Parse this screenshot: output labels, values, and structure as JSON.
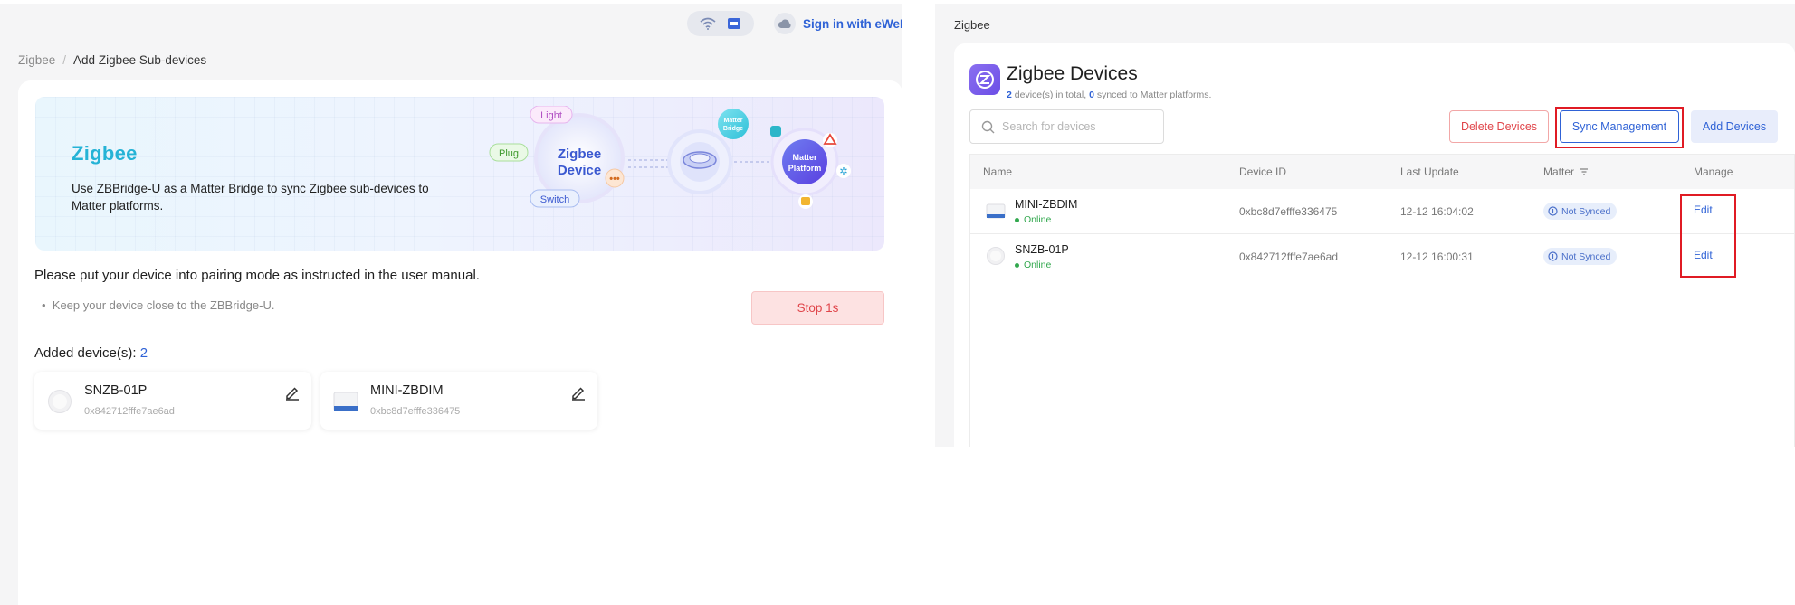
{
  "left": {
    "topbar": {
      "wifi_icon": "wifi-icon",
      "device_icon": "bridge-icon",
      "cloud_icon": "cloud-icon",
      "signin_label": "Sign in with eWeLi"
    },
    "breadcrumb": {
      "root": "Zigbee",
      "separator": "/",
      "current": "Add Zigbee Sub-devices"
    },
    "banner": {
      "brand": "Zigbee",
      "description": "Use ZBBridge-U as a Matter Bridge to sync Zigbee sub-devices to Matter platforms.",
      "illustration": {
        "center_line1": "Zigbee",
        "center_line2": "Device",
        "tag_light": "Light",
        "tag_plug": "Plug",
        "tag_switch": "Switch",
        "matter_bridge_line1": "Matter",
        "matter_bridge_line2": "Bridge",
        "matter_platform_line1": "Matter",
        "matter_platform_line2": "Platform"
      }
    },
    "instruction": "Please put your device into pairing mode as instructed in the user manual.",
    "tip": "Keep your device close to the ZBBridge-U.",
    "stop_button": "Stop 1s",
    "added_label": "Added device(s):",
    "added_count": "2",
    "devices": [
      {
        "name": "SNZB-01P",
        "id": "0x842712fffe7ae6ad",
        "icon": "round-button-device-icon"
      },
      {
        "name": "MINI-ZBDIM",
        "id": "0xbc8d7efffe336475",
        "icon": "dimmer-module-icon"
      }
    ]
  },
  "right": {
    "page_title": "Zigbee",
    "header": {
      "title": "Zigbee Devices",
      "count": "2",
      "count_text": "device(s) in total,",
      "synced": "0",
      "synced_text": "synced to Matter platforms."
    },
    "search": {
      "placeholder": "Search for devices"
    },
    "buttons": {
      "delete": "Delete Devices",
      "sync": "Sync Management",
      "add": "Add Devices"
    },
    "table": {
      "columns": [
        "Name",
        "Device ID",
        "Last Update",
        "Matter",
        "Manage"
      ],
      "rows": [
        {
          "name": "MINI-ZBDIM",
          "status": "Online",
          "device_id": "0xbc8d7efffe336475",
          "last_update": "12-12 16:04:02",
          "matter": "Not Synced",
          "manage": "Edit"
        },
        {
          "name": "SNZB-01P",
          "status": "Online",
          "device_id": "0x842712fffe7ae6ad",
          "last_update": "12-12 16:00:31",
          "matter": "Not Synced",
          "manage": "Edit"
        }
      ]
    },
    "colors": {
      "primary": "#2f62d6",
      "danger": "#e0454a",
      "highlight": "#e01b24",
      "online": "#32a84e"
    }
  }
}
